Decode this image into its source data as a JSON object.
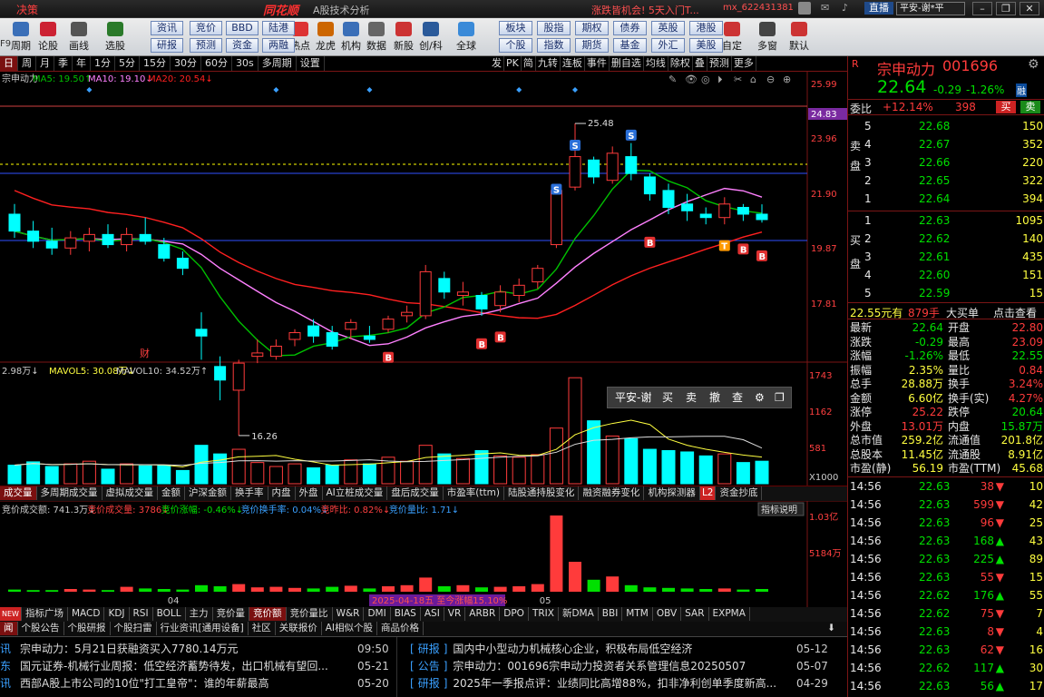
{
  "titlebar": {
    "left_text": "决策",
    "logo": "同花顺",
    "subtitle": "A股技术分析",
    "promo": "涨跌皆机会! 5天入门T...",
    "user": "mx_622431381",
    "live_btn": "直播",
    "account": "平安-谢*平"
  },
  "toolbar": [
    {
      "label": "周期",
      "icon": "period-icon"
    },
    {
      "label": "论股",
      "icon": "discuss-icon"
    },
    {
      "label": "画线",
      "icon": "draw-line-icon"
    },
    {
      "label": "选股",
      "icon": "stock-pick-icon"
    },
    {
      "label": "热点",
      "icon": "hotspot-icon"
    },
    {
      "label": "龙虎",
      "icon": "dragon-tiger-icon"
    },
    {
      "label": "机构",
      "icon": "institution-icon"
    },
    {
      "label": "数据",
      "icon": "data-icon"
    },
    {
      "label": "新股",
      "icon": "ipo-icon"
    },
    {
      "label": "创/科",
      "icon": "chuang-icon"
    },
    {
      "label": "全球",
      "icon": "globe-icon"
    },
    {
      "label": "自定",
      "icon": "custom-icon"
    },
    {
      "label": "多窗",
      "icon": "multiwindow-icon"
    },
    {
      "label": "默认",
      "icon": "home-icon"
    }
  ],
  "toolbar_buttons": [
    "资讯",
    "竞价",
    "BBD",
    "陆港",
    "研报",
    "预测",
    "资金",
    "两融",
    "板块",
    "股指",
    "期权",
    "债券",
    "英股",
    "港股",
    "个股",
    "指数",
    "期货",
    "基金",
    "外汇",
    "美股"
  ],
  "period_bar": {
    "items": [
      "日",
      "周",
      "月",
      "季",
      "年",
      "1分",
      "5分",
      "15分",
      "30分",
      "60分",
      "30s",
      "多周期",
      "设置"
    ],
    "right_items": [
      "发",
      "PK",
      "简",
      "九转",
      "连板",
      "事件",
      "删自选",
      "均线",
      "除权",
      "叠",
      "预测",
      "更多"
    ]
  },
  "chart": {
    "stock_label": "宗申动力",
    "ma5": "MA5: 19.50↑",
    "ma10": "MA10: 19.10↓",
    "ma20": "MA20: 20.54↓",
    "price_axis": [
      "25.99",
      "24.83",
      "23.96",
      "21.90",
      "19.87",
      "17.81"
    ],
    "current_price_tag": "24.83",
    "high_marker": "25.48",
    "low_marker": "16.26",
    "fin_marker": "财",
    "vol_label": "2.98万↓",
    "mavol5": "MAVOL5: 30.08万↓",
    "mavol10": "MAVOL10: 34.52万↑",
    "vol_axis": [
      "1743",
      "1162",
      "581",
      "X1000"
    ],
    "auction_header": [
      "竞价成交额: 741.3万↓",
      "竞价成交量: 3786↓",
      "竞价涨幅: -0.46%↓",
      "竞价换手率: 0.04%↓",
      "竞昨比: 0.82%↓",
      "竞价量比: 1.71↓"
    ],
    "auction_axis": [
      "1.03亿",
      "5184万"
    ],
    "indicator_btn": "指标说明",
    "date_labels": [
      "04",
      "05"
    ],
    "tooltip": "2025-04-18五 至今涨幅15.10%"
  },
  "trade_panel": {
    "account": "平安-谢",
    "buy": "买",
    "sell": "卖",
    "cancel": "撤",
    "query": "查"
  },
  "indicator_tabs": [
    "成交量",
    "多周期成交量",
    "虚拟成交量",
    "金额",
    "沪深金额",
    "换手率",
    "内盘",
    "外盘",
    "AI立桩成交量",
    "盘后成交量",
    "市盈率(ttm)",
    "陆股通持股变化",
    "融资融券变化",
    "机构探测器",
    "L2",
    "资金抄底"
  ],
  "formula_tabs": [
    "指标广场",
    "MACD",
    "KDJ",
    "RSI",
    "BOLL",
    "主力",
    "竞价量",
    "竞价额",
    "竞价量比",
    "W&R",
    "DMI",
    "BIAS",
    "ASI",
    "VR",
    "ARBR",
    "DPO",
    "TRIX",
    "新DMA",
    "BBI",
    "MTM",
    "OBV",
    "SAR",
    "EXPMA"
  ],
  "news_tabs": [
    "闻",
    "个股公告",
    "个股研报",
    "个股扫雷",
    "行业资讯[通用设备]",
    "社区",
    "关联报价",
    "AI相似个股",
    "商品价格"
  ],
  "news_left": [
    {
      "tag": "讯",
      "title": "宗申动力：5月21日获融资买入7780.14万元",
      "date": "09:50"
    },
    {
      "tag": "东",
      "title": "国元证券-机械行业周报：低空经济蓄势待发，出口机械有望回...",
      "date": "05-21"
    },
    {
      "tag": "讯",
      "title": "西部A股上市公司的10位\"打工皇帝\"：谁的年薪最高",
      "date": "05-20"
    }
  ],
  "news_right": [
    {
      "tag": "研报",
      "title": "国内中小型动力机械核心企业，积极布局低空经济",
      "date": "05-12"
    },
    {
      "tag": "公告",
      "title": "宗申动力：001696宗申动力投资者关系管理信息20250507",
      "date": "05-07"
    },
    {
      "tag": "研报",
      "title": "2025年一季报点评：业绩同比高增88%，扣非净利创单季度新高...",
      "date": "04-29"
    }
  ],
  "quote": {
    "name": "宗申动力",
    "code": "001696",
    "price": "22.64",
    "change": "-0.29",
    "pct": "-1.26%",
    "tag": "融",
    "weibi_label": "委比",
    "weibi": "+12.14%",
    "weicha": "398",
    "buy_btn": "买",
    "sell_btn": "卖",
    "sell_side_label": "卖盘",
    "buy_side_label": "买盘",
    "asks": [
      {
        "lvl": "5",
        "price": "22.68",
        "vol": "150"
      },
      {
        "lvl": "4",
        "price": "22.67",
        "vol": "352"
      },
      {
        "lvl": "3",
        "price": "22.66",
        "vol": "220"
      },
      {
        "lvl": "2",
        "price": "22.65",
        "vol": "322"
      },
      {
        "lvl": "1",
        "price": "22.64",
        "vol": "394"
      }
    ],
    "bids": [
      {
        "lvl": "1",
        "price": "22.63",
        "vol": "1095"
      },
      {
        "lvl": "2",
        "price": "22.62",
        "vol": "140"
      },
      {
        "lvl": "3",
        "price": "22.61",
        "vol": "435"
      },
      {
        "lvl": "4",
        "price": "22.60",
        "vol": "151"
      },
      {
        "lvl": "5",
        "price": "22.59",
        "vol": "15"
      }
    ],
    "big_order": {
      "price": "22.55元有",
      "vol": "879手",
      "text": "大买单",
      "link": "点击查看"
    },
    "stats": [
      [
        "最新",
        "22.64",
        "开盘",
        "22.80"
      ],
      [
        "涨跌",
        "-0.29",
        "最高",
        "23.09"
      ],
      [
        "涨幅",
        "-1.26%",
        "最低",
        "22.55"
      ],
      [
        "振幅",
        "2.35%",
        "量比",
        "0.84"
      ],
      [
        "总手",
        "28.88万",
        "换手",
        "3.24%"
      ],
      [
        "金额",
        "6.60亿",
        "换手(实)",
        "4.27%"
      ],
      [
        "涨停",
        "25.22",
        "跌停",
        "20.64"
      ],
      [
        "外盘",
        "13.01万",
        "内盘",
        "15.87万"
      ],
      [
        "总市值",
        "259.2亿",
        "流通值",
        "201.8亿"
      ],
      [
        "总股本",
        "11.45亿",
        "流通股",
        "8.91亿"
      ],
      [
        "市盈(静)",
        "56.19",
        "市盈(TTM)",
        "45.68"
      ]
    ],
    "ticks": [
      {
        "time": "14:56",
        "price": "22.63",
        "vol": "38",
        "dir": "down",
        "n": "10"
      },
      {
        "time": "14:56",
        "price": "22.63",
        "vol": "599",
        "dir": "down",
        "n": "42"
      },
      {
        "time": "14:56",
        "price": "22.63",
        "vol": "96",
        "dir": "down",
        "n": "25"
      },
      {
        "time": "14:56",
        "price": "22.63",
        "vol": "168",
        "dir": "up",
        "n": "43"
      },
      {
        "time": "14:56",
        "price": "22.63",
        "vol": "225",
        "dir": "up",
        "n": "89"
      },
      {
        "time": "14:56",
        "price": "22.63",
        "vol": "55",
        "dir": "down",
        "n": "15"
      },
      {
        "time": "14:56",
        "price": "22.62",
        "vol": "176",
        "dir": "up",
        "n": "55"
      },
      {
        "time": "14:56",
        "price": "22.62",
        "vol": "75",
        "dir": "down",
        "n": "7"
      },
      {
        "time": "14:56",
        "price": "22.63",
        "vol": "8",
        "dir": "down",
        "n": "4"
      },
      {
        "time": "14:56",
        "price": "22.63",
        "vol": "62",
        "dir": "down",
        "n": "16"
      },
      {
        "time": "14:56",
        "price": "22.62",
        "vol": "117",
        "dir": "up",
        "n": "30"
      },
      {
        "time": "14:56",
        "price": "22.63",
        "vol": "56",
        "dir": "up",
        "n": "17"
      }
    ]
  },
  "colors": {
    "up": "#ff3b3b",
    "down": "#00ffff",
    "ma5": "#00c000",
    "ma10": "#ff80ff",
    "ma20": "#ff2020",
    "auction": "#00e000"
  },
  "candles": [
    {
      "o": 22.8,
      "h": 23.1,
      "l": 22.1,
      "c": 22.3
    },
    {
      "o": 22.3,
      "h": 22.6,
      "l": 21.8,
      "c": 22.0
    },
    {
      "o": 22.0,
      "h": 22.4,
      "l": 21.6,
      "c": 21.8
    },
    {
      "o": 21.8,
      "h": 22.3,
      "l": 21.6,
      "c": 22.1
    },
    {
      "o": 22.0,
      "h": 22.4,
      "l": 21.7,
      "c": 22.2
    },
    {
      "o": 22.2,
      "h": 22.5,
      "l": 21.8,
      "c": 21.9
    },
    {
      "o": 21.9,
      "h": 22.4,
      "l": 21.7,
      "c": 22.2
    },
    {
      "o": 22.2,
      "h": 22.7,
      "l": 21.9,
      "c": 22.0
    },
    {
      "o": 21.9,
      "h": 22.1,
      "l": 21.4,
      "c": 21.5
    },
    {
      "o": 21.5,
      "h": 21.7,
      "l": 21.0,
      "c": 21.2
    },
    {
      "o": 19.4,
      "h": 19.9,
      "l": 18.5,
      "c": 19.2
    },
    {
      "o": 18.3,
      "h": 18.6,
      "l": 17.3,
      "c": 17.9
    },
    {
      "o": 17.6,
      "h": 18.5,
      "l": 16.26,
      "c": 18.4
    },
    {
      "o": 18.6,
      "h": 19.1,
      "l": 18.4,
      "c": 18.7
    },
    {
      "o": 18.6,
      "h": 19.1,
      "l": 18.5,
      "c": 18.9
    },
    {
      "o": 19.1,
      "h": 19.4,
      "l": 18.9,
      "c": 19.3
    },
    {
      "o": 19.5,
      "h": 19.7,
      "l": 19.0,
      "c": 19.2
    },
    {
      "o": 19.3,
      "h": 19.5,
      "l": 18.8,
      "c": 18.9
    },
    {
      "o": 19.4,
      "h": 19.7,
      "l": 19.1,
      "c": 19.6
    },
    {
      "o": 19.2,
      "h": 19.5,
      "l": 19.0,
      "c": 19.1
    },
    {
      "o": 19.4,
      "h": 19.8,
      "l": 19.3,
      "c": 19.7
    },
    {
      "o": 19.8,
      "h": 20.1,
      "l": 19.6,
      "c": 19.9
    },
    {
      "o": 19.8,
      "h": 21.3,
      "l": 19.7,
      "c": 21.1
    },
    {
      "o": 20.9,
      "h": 21.1,
      "l": 20.3,
      "c": 20.5
    },
    {
      "o": 20.4,
      "h": 20.8,
      "l": 20.1,
      "c": 20.5
    },
    {
      "o": 20.4,
      "h": 20.5,
      "l": 19.8,
      "c": 20.0
    },
    {
      "o": 20.1,
      "h": 20.7,
      "l": 19.9,
      "c": 20.5
    },
    {
      "o": 20.4,
      "h": 20.9,
      "l": 20.2,
      "c": 20.7
    },
    {
      "o": 20.8,
      "h": 21.3,
      "l": 20.6,
      "c": 21.2
    },
    {
      "o": 21.9,
      "h": 23.6,
      "l": 21.8,
      "c": 23.5
    },
    {
      "o": 23.6,
      "h": 25.48,
      "l": 23.5,
      "c": 24.5
    },
    {
      "o": 24.4,
      "h": 24.5,
      "l": 23.7,
      "c": 23.9
    },
    {
      "o": 23.8,
      "h": 24.8,
      "l": 23.7,
      "c": 24.6
    },
    {
      "o": 24.5,
      "h": 24.9,
      "l": 23.8,
      "c": 24.0
    },
    {
      "o": 23.9,
      "h": 24.0,
      "l": 23.2,
      "c": 23.4
    },
    {
      "o": 23.5,
      "h": 23.7,
      "l": 22.8,
      "c": 23.0
    },
    {
      "o": 23.1,
      "h": 23.4,
      "l": 22.6,
      "c": 22.9
    },
    {
      "o": 22.8,
      "h": 23.0,
      "l": 22.5,
      "c": 22.7
    },
    {
      "o": 22.7,
      "h": 23.3,
      "l": 22.5,
      "c": 23.1
    },
    {
      "o": 23.0,
      "h": 23.1,
      "l": 22.6,
      "c": 22.8
    },
    {
      "o": 22.8,
      "h": 23.09,
      "l": 22.55,
      "c": 22.64
    }
  ],
  "volumes": [
    28,
    33,
    26,
    30,
    34,
    22,
    30,
    27,
    28,
    20,
    58,
    45,
    52,
    32,
    26,
    30,
    24,
    28,
    36,
    30,
    40,
    34,
    58,
    45,
    38,
    50,
    42,
    40,
    44,
    84,
    160,
    95,
    72,
    68,
    52,
    50,
    48,
    42,
    45,
    32,
    34
  ],
  "auction": [
    4,
    3,
    3,
    5,
    4,
    3,
    9,
    6,
    5,
    4,
    12,
    10,
    14,
    8,
    9,
    7,
    6,
    9,
    11,
    6,
    10,
    12,
    26,
    10,
    12,
    8,
    9,
    10,
    14,
    140,
    55,
    22,
    28,
    12,
    8,
    7,
    6,
    5,
    6,
    4,
    5
  ]
}
